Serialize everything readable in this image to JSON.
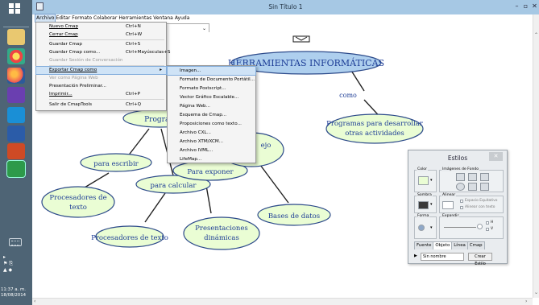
{
  "window": {
    "title": "Sin Título 1"
  },
  "menubar": {
    "items": [
      "Archivo",
      "Editar",
      "Formato",
      "Colaborar",
      "Herramientas",
      "Ventana",
      "Ayuda"
    ],
    "active": "Archivo"
  },
  "file_menu": [
    {
      "label": "Nuevo Cmap",
      "shortcut": "Ctrl+N"
    },
    {
      "label": "Cerrar Cmap",
      "shortcut": "Ctrl+W"
    },
    {
      "label": "Guardar Cmap",
      "shortcut": "Ctrl+S"
    },
    {
      "label": "Guardar Cmap como...",
      "shortcut": "Ctrl+Mayúsculas+S"
    },
    {
      "label": "Guardar Sesión de Conversación",
      "shortcut": "",
      "disabled": true
    },
    {
      "label": "Exportar Cmap como",
      "shortcut": "",
      "highlighted": true,
      "submenu": true
    },
    {
      "label": "Ver como Página Web",
      "shortcut": "",
      "disabled": true
    },
    {
      "label": "Presentación Preliminar...",
      "shortcut": ""
    },
    {
      "label": "Imprimir...",
      "shortcut": "Ctrl+P"
    },
    {
      "label": "Salir de CmapTools",
      "shortcut": "Ctrl+Q"
    }
  ],
  "export_submenu": [
    "Imagen...",
    "Formato de Documento Portátil...",
    "Formato Postscript...",
    "Vector Gráfico Escalable...",
    "Página Web...",
    "Esquema de Cmap...",
    "Proposiciones como texto...",
    "Archivo CXL...",
    "Archivo XTM/XCM...",
    "Archivo IVML...",
    "LifeMap..."
  ],
  "concept_map": {
    "nodes": [
      "HERRAMIENTAS INFORMÁTICAS",
      "Programas",
      "Programas para desarrollar otras actividades",
      "para escribir",
      "para calcular",
      "Para exponer",
      "manejo datos",
      "Procesadores de texto",
      "Hoja de cálculo",
      "Presentaciones dinámicas",
      "Bases de datos"
    ],
    "links": [
      "como",
      "en"
    ]
  },
  "styles_panel": {
    "title": "Estilos",
    "color_label": "Color",
    "images_label": "Imágenes de Fondo",
    "shadow_label": "Sombra",
    "align_label": "Alinear",
    "equal_space": "Espacio Equitativo",
    "align_text": "Alinear con texto",
    "shape_label": "Forma",
    "expand_label": "Expandir",
    "h_label": "H",
    "v_label": "V",
    "tabs": [
      "Fuente",
      "Objeto",
      "Línea",
      "Cmap"
    ],
    "active_tab": "Objeto",
    "name_value": "Sin nombre",
    "create_style": "Crear Estilo"
  },
  "clock": {
    "time": "11:37 a. m.",
    "date": "18/08/2014"
  },
  "colors": {
    "node_fill": "#eafdd4",
    "node_border": "#2c4a8a",
    "title_fill": "#aecfee",
    "text": "#1d3d96",
    "menu_highlight": "#cfe3f6"
  }
}
